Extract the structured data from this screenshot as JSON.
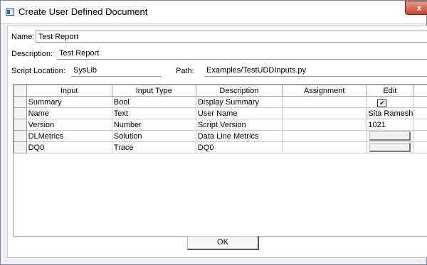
{
  "window": {
    "title": "Create User Defined Document",
    "close_glyph": "x"
  },
  "form": {
    "name_label": "Name:",
    "name_value": "Test Report",
    "description_label": "Description:",
    "description_value": "Test Report",
    "script_location_label": "Script Location:",
    "script_location_value": "SysLib",
    "path_label": "Path:",
    "path_value": "Examples/TestUDDInputs.py"
  },
  "table": {
    "headers": [
      "Input",
      "Input Type",
      "Description",
      "Assignment",
      "Edit"
    ],
    "rows": [
      {
        "input": "Summary",
        "type": "Bool",
        "description": "Display Summary",
        "assignment": "",
        "edit": "checkbox-checked"
      },
      {
        "input": "Name",
        "type": "Text",
        "description": "User Name",
        "assignment": "",
        "edit": "Sita Ramesh"
      },
      {
        "input": "Version",
        "type": "Number",
        "description": "Script Version",
        "assignment": "",
        "edit": "1021"
      },
      {
        "input": "DLMetrics",
        "type": "Solution",
        "description": "Data Line Metrics",
        "assignment": "",
        "edit": "button"
      },
      {
        "input": "DQ0",
        "type": "Trace",
        "description": "DQ0",
        "assignment": "",
        "edit": "button"
      }
    ]
  },
  "ok_label": "OK",
  "icons": {
    "app": "window-app-icon",
    "close": "close-icon",
    "check": "checkmark-icon"
  }
}
